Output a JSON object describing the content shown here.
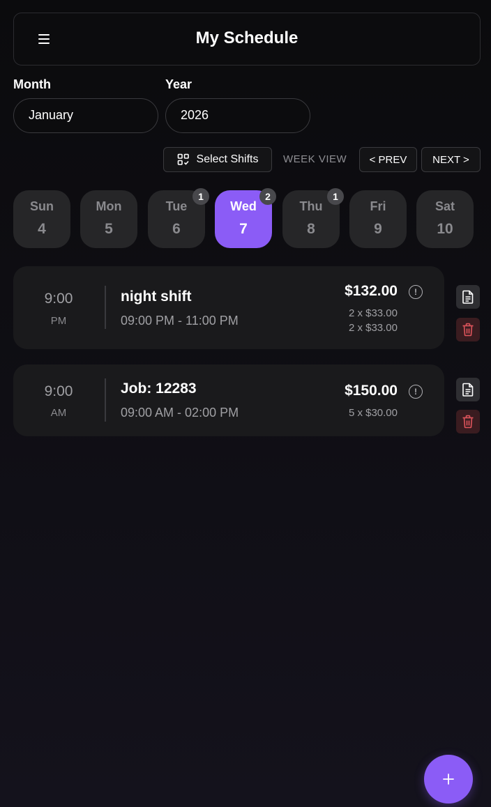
{
  "header": {
    "title": "My Schedule"
  },
  "filters": {
    "month_label": "Month",
    "month_value": "January",
    "year_label": "Year",
    "year_value": "2026"
  },
  "toolbar": {
    "select_shifts": "Select Shifts",
    "week_view": "WEEK VIEW",
    "prev": "< PREV",
    "next": "NEXT >"
  },
  "days": [
    {
      "name": "Sun",
      "num": "4",
      "badge": ""
    },
    {
      "name": "Mon",
      "num": "5",
      "badge": ""
    },
    {
      "name": "Tue",
      "num": "6",
      "badge": "1"
    },
    {
      "name": "Wed",
      "num": "7",
      "badge": "2",
      "active": true
    },
    {
      "name": "Thu",
      "num": "8",
      "badge": "1"
    },
    {
      "name": "Fri",
      "num": "9",
      "badge": ""
    },
    {
      "name": "Sat",
      "num": "10",
      "badge": ""
    }
  ],
  "shifts": [
    {
      "start_time": "9:00",
      "meridiem": "PM",
      "title": "night shift",
      "range": "09:00 PM - 11:00 PM",
      "amount": "$132.00",
      "breakdown": [
        "2 x $33.00",
        "2 x $33.00"
      ]
    },
    {
      "start_time": "9:00",
      "meridiem": "AM",
      "title": "Job: 12283",
      "range": "09:00 AM - 02:00 PM",
      "amount": "$150.00",
      "breakdown": [
        "5 x $30.00"
      ]
    }
  ],
  "colors": {
    "accent": "#8b5cf6",
    "delete": "#e0555c",
    "card": "#1a1a1c"
  },
  "icons": {
    "menu": "hamburger-icon",
    "select_shifts": "grid-check-icon",
    "info": "info-icon",
    "doc": "document-icon",
    "delete": "trash-icon",
    "add": "plus-icon"
  }
}
